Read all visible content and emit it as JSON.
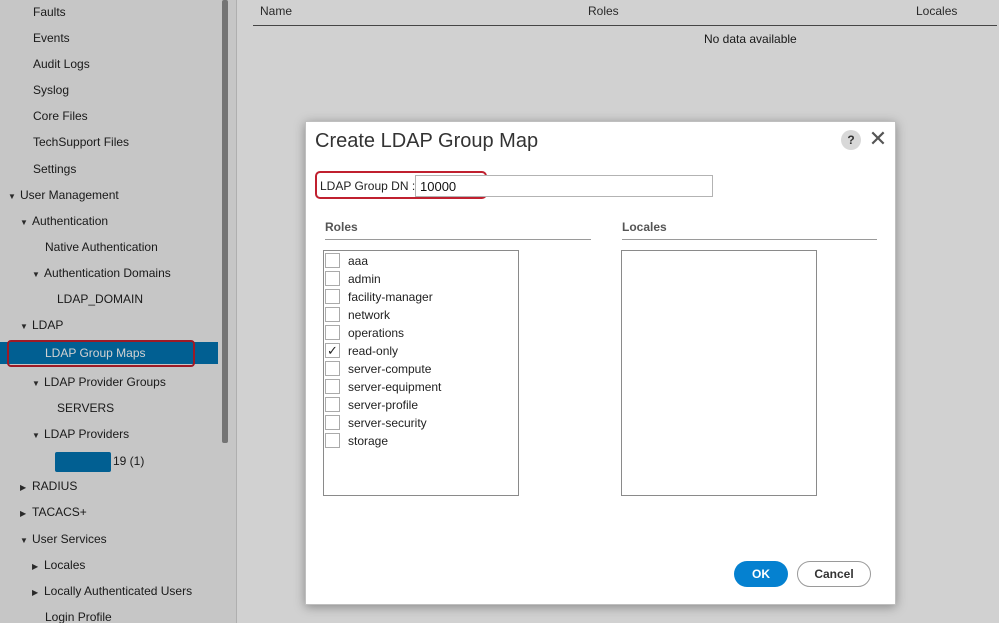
{
  "sidebar": {
    "items": [
      {
        "label": "Faults",
        "caret": ""
      },
      {
        "label": "Events",
        "caret": ""
      },
      {
        "label": "Audit Logs",
        "caret": ""
      },
      {
        "label": "Syslog",
        "caret": ""
      },
      {
        "label": "Core Files",
        "caret": ""
      },
      {
        "label": "TechSupport Files",
        "caret": ""
      },
      {
        "label": "Settings",
        "caret": ""
      },
      {
        "label": "User Management",
        "caret": "▼"
      },
      {
        "label": "Authentication",
        "caret": "▼"
      },
      {
        "label": "Native Authentication",
        "caret": ""
      },
      {
        "label": "Authentication Domains",
        "caret": "▼"
      },
      {
        "label": "LDAP_DOMAIN",
        "caret": ""
      },
      {
        "label": "LDAP",
        "caret": "▼"
      },
      {
        "label": "LDAP Group Maps",
        "caret": ""
      },
      {
        "label": "LDAP Provider Groups",
        "caret": "▼"
      },
      {
        "label": "SERVERS",
        "caret": ""
      },
      {
        "label": "LDAP Providers",
        "caret": "▼"
      },
      {
        "label": "19 (1)",
        "caret": ""
      },
      {
        "label": "RADIUS",
        "caret": "▶"
      },
      {
        "label": "TACACS+",
        "caret": "▶"
      },
      {
        "label": "User Services",
        "caret": "▼"
      },
      {
        "label": "Locales",
        "caret": "▶"
      },
      {
        "label": "Locally Authenticated Users",
        "caret": "▶"
      },
      {
        "label": "Login Profile",
        "caret": ""
      }
    ]
  },
  "table": {
    "columns": [
      "Name",
      "Roles",
      "Locales"
    ],
    "empty_text": "No data available"
  },
  "dialog": {
    "title": "Create LDAP Group Map",
    "help_label": "?",
    "close_label": "✕",
    "dn_label": "LDAP Group DN :",
    "dn_value": "10000",
    "roles_title": "Roles",
    "locales_title": "Locales",
    "roles": [
      {
        "label": "aaa",
        "checked": false
      },
      {
        "label": "admin",
        "checked": false
      },
      {
        "label": "facility-manager",
        "checked": false
      },
      {
        "label": "network",
        "checked": false
      },
      {
        "label": "operations",
        "checked": false
      },
      {
        "label": "read-only",
        "checked": true
      },
      {
        "label": "server-compute",
        "checked": false
      },
      {
        "label": "server-equipment",
        "checked": false
      },
      {
        "label": "server-profile",
        "checked": false
      },
      {
        "label": "server-security",
        "checked": false
      },
      {
        "label": "storage",
        "checked": false
      }
    ],
    "ok_label": "OK",
    "cancel_label": "Cancel"
  },
  "colors": {
    "selected_bg": "#0274b3",
    "highlight_outline": "#c0202f",
    "ok_button": "#0581d0"
  }
}
